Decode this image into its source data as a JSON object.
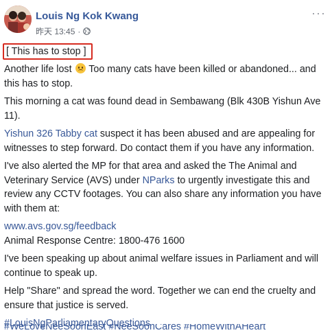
{
  "post": {
    "author": "Louis Ng Kok Kwang",
    "timestamp": "昨天 13:45",
    "dot": "·",
    "more_label": "···",
    "title": "[ This has to stop ]",
    "para1_a": "Another life lost",
    "para1_b": "Too many cats have been killed or abandoned... and this has to stop.",
    "para2": "This morning a cat was found dead in Sembawang (Blk 430B Yishun Ave 11).",
    "para3_link": "Yishun 326 Tabby cat",
    "para3_text": "suspect it has been abused and are appealing for witnesses to step forward. Do contact them if you have any information.",
    "para4_a": "I've also alerted the MP for that area and asked the The Animal and Veterinary Service (AVS) under",
    "para4_link": "NParks",
    "para4_b": "to urgently investigate this and review any CCTV footages. You can also share any information you have with them at:",
    "avs_link": "www.avs.gov.sg/feedback",
    "hotline": "Animal Response Centre: 1800-476 1600",
    "para5": "I've been speaking up about animal welfare issues in Parliament and will continue to speak up.",
    "para6": "Help \"Share\" and spread the word. Together we can end the cruelty and ensure that justice is served.",
    "hashtag1": "#LouisNgParliamentaryQuestions",
    "hashtags2": "#WeLoveNeeSoonEast #NeeSoonCares #HomeWithAHeart"
  }
}
